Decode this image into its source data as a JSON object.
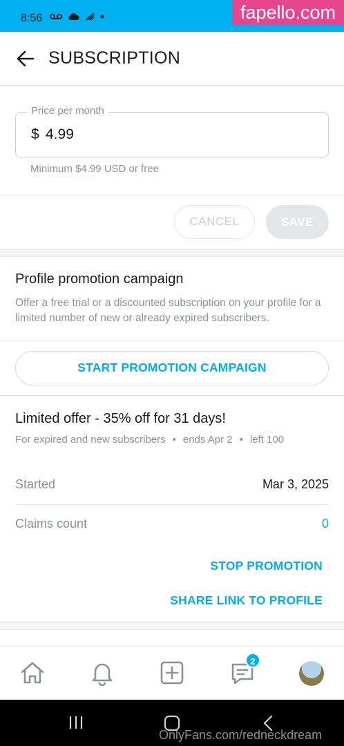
{
  "status_bar": {
    "time": "8:56",
    "icons": [
      "voicemail-icon",
      "cloud-icon",
      "wifi-call-icon",
      "dot-icon"
    ]
  },
  "watermark_top": "fapello.com",
  "header": {
    "title": "SUBSCRIPTION"
  },
  "price": {
    "legend": "Price per month",
    "currency": "$",
    "value": "4.99",
    "hint": "Minimum $4.99 USD or free"
  },
  "actions": {
    "cancel": "CANCEL",
    "save": "SAVE"
  },
  "promotion": {
    "title": "Profile promotion campaign",
    "description": "Offer a free trial or a discounted subscription on your profile for a limited number of new or already expired subscribers.",
    "start_button": "START PROMOTION CAMPAIGN"
  },
  "offer": {
    "title": "Limited offer - 35% off for 31 days!",
    "audience": "For expired and new subscribers",
    "ends": "ends Apr 2",
    "left": "left 100",
    "started_label": "Started",
    "started_value": "Mar 3, 2025",
    "claims_label": "Claims count",
    "claims_value": "0",
    "stop_button": "STOP PROMOTION",
    "share_button": "SHARE LINK TO PROFILE"
  },
  "bottom_nav": {
    "messages_badge": "2"
  },
  "watermark_bottom": "OnlyFans.com/redneckdream",
  "colors": {
    "accent": "#00aff0",
    "muted": "#8a9196",
    "watermark": "#e6468f"
  }
}
